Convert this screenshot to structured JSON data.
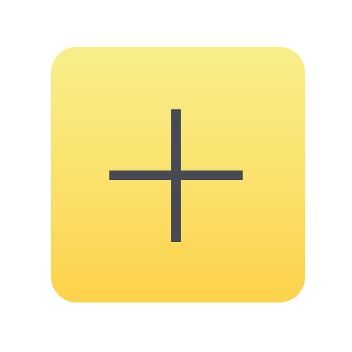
{
  "icon": {
    "name": "plus-icon",
    "tile_color_top": "#f8ef8a",
    "tile_color_bottom": "#fdd24a",
    "glyph_color": "#474a54"
  }
}
